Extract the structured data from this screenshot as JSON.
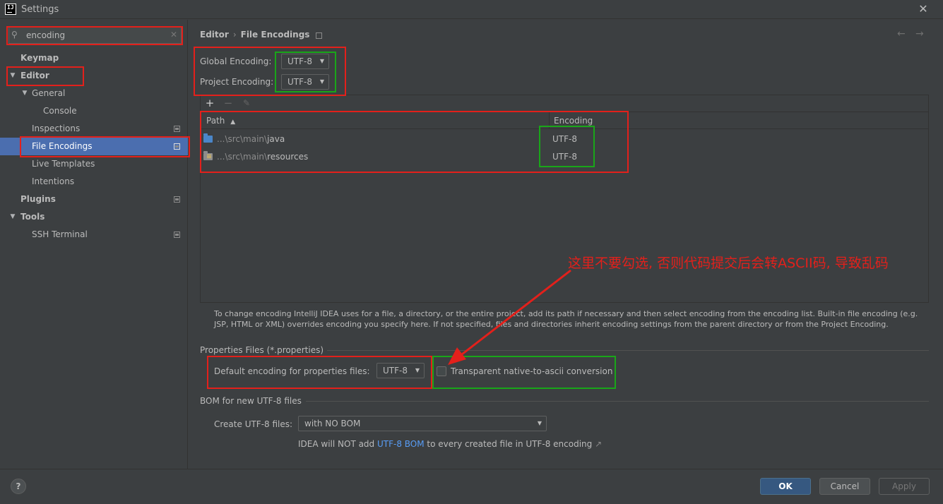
{
  "window": {
    "title": "Settings",
    "app_icon": "IJ"
  },
  "search": {
    "value": "encoding"
  },
  "sidebar": {
    "items": [
      {
        "label": "Keymap"
      },
      {
        "label": "Editor"
      },
      {
        "label": "General"
      },
      {
        "label": "Console"
      },
      {
        "label": "Inspections"
      },
      {
        "label": "File Encodings"
      },
      {
        "label": "Live Templates"
      },
      {
        "label": "Intentions"
      },
      {
        "label": "Plugins"
      },
      {
        "label": "Tools"
      },
      {
        "label": "SSH Terminal"
      }
    ]
  },
  "breadcrumb": {
    "parent": "Editor",
    "separator": "›",
    "current": "File Encodings"
  },
  "encodings": {
    "global_label": "Global Encoding:",
    "global_value": "UTF-8",
    "project_label": "Project Encoding:",
    "project_value": "UTF-8"
  },
  "table": {
    "toolbar": {
      "add": "+",
      "remove": "−",
      "edit": "✎"
    },
    "columns": {
      "path": "Path",
      "sort": "▲",
      "encoding": "Encoding"
    },
    "rows": [
      {
        "path_prefix": "...\\src\\main\\",
        "path_leaf": "java",
        "encoding": "UTF-8"
      },
      {
        "path_prefix": "...\\src\\main\\",
        "path_leaf": "resources",
        "encoding": "UTF-8"
      }
    ]
  },
  "info_text": "To change encoding IntelliJ IDEA uses for a file, a directory, or the entire project, add its path if necessary and then select encoding from the encoding list. Built-in file encoding (e.g. JSP, HTML or XML) overrides encoding you specify here. If not specified, files and directories inherit encoding settings from the parent directory or from the Project Encoding.",
  "properties": {
    "section_title": "Properties Files (*.properties)",
    "default_label": "Default encoding for properties files:",
    "default_value": "UTF-8",
    "transparent_label": "Transparent native-to-ascii conversion",
    "transparent_checked": false
  },
  "bom": {
    "section_title": "BOM for new UTF-8 files",
    "create_label": "Create UTF-8 files:",
    "create_value": "with NO BOM",
    "note_prefix": "IDEA will NOT add ",
    "note_link": "UTF-8 BOM",
    "note_suffix": " to every created file in UTF-8 encoding",
    "note_ext": "↗"
  },
  "annotation": {
    "text": "这里不要勾选, 否则代码提交后会转ASCII码, 导致乱码",
    "colors": {
      "red": "#e3201b",
      "green": "#19a619"
    }
  },
  "footer": {
    "help": "?",
    "ok": "OK",
    "cancel": "Cancel",
    "apply": "Apply"
  },
  "theme": {
    "background": "#3c3f41",
    "selection": "#4b6eaf",
    "accent": "#365880",
    "link": "#589df6"
  }
}
